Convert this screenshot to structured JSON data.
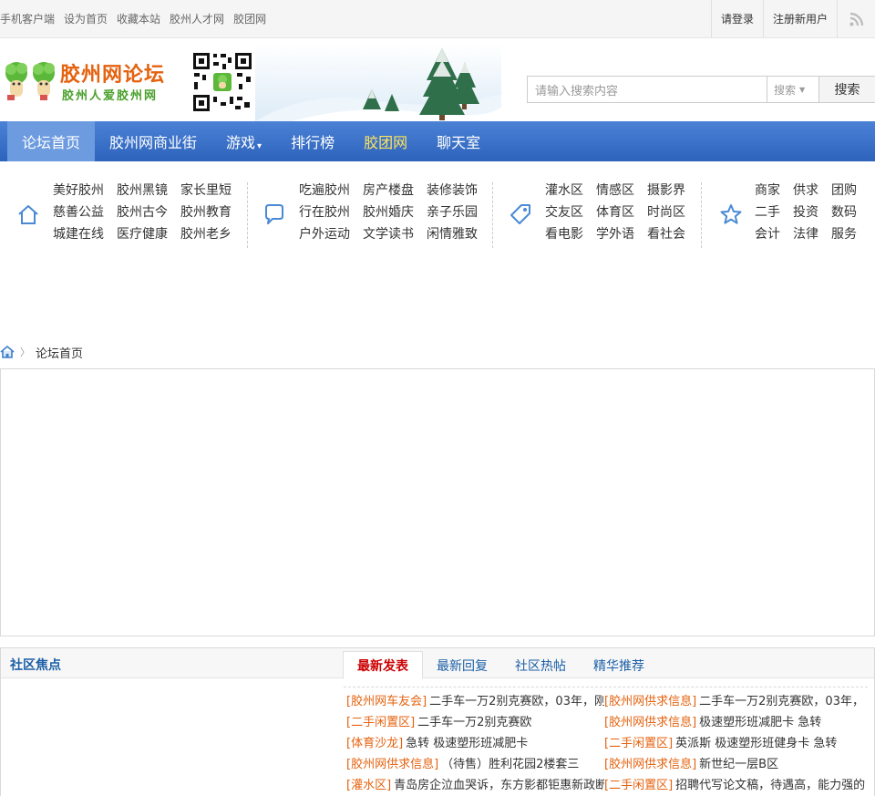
{
  "topbar": {
    "links": [
      "手机客户端",
      "设为首页",
      "收藏本站",
      "胶州人才网",
      "胶团网"
    ],
    "login": "请登录",
    "register": "注册新用户",
    "rss_icon": "rss-icon"
  },
  "header": {
    "logo_title": "胶州网论坛",
    "logo_subtitle": "胶州人爱胶州网",
    "search_placeholder": "请输入搜索内容",
    "search_type": "搜索",
    "search_button": "搜索"
  },
  "nav": {
    "items": [
      "论坛首页",
      "胶州网商业街",
      "游戏",
      "排行榜",
      "胶团网",
      "聊天室"
    ]
  },
  "quick": {
    "groups": [
      {
        "icon": "home-icon",
        "links": [
          "美好胶州",
          "胶州黑镜",
          "家长里短",
          "慈善公益",
          "胶州古今",
          "胶州教育",
          "城建在线",
          "医疗健康",
          "胶州老乡"
        ]
      },
      {
        "icon": "chat-bubble-icon",
        "links": [
          "吃遍胶州",
          "房产楼盘",
          "装修装饰",
          "行在胶州",
          "胶州婚庆",
          "亲子乐园",
          "户外运动",
          "文学读书",
          "闲情雅致"
        ]
      },
      {
        "icon": "tag-icon",
        "links": [
          "灌水区",
          "情感区",
          "摄影界",
          "交友区",
          "体育区",
          "时尚区",
          "看电影",
          "学外语",
          "看社会"
        ]
      },
      {
        "icon": "star-icon",
        "links": [
          "商家",
          "供求",
          "团购",
          "二手",
          "投资",
          "数码",
          "会计",
          "法律",
          "服务"
        ]
      }
    ]
  },
  "breadcrumb": {
    "home_icon": "home-icon",
    "label": "论坛首页"
  },
  "focus": {
    "title": "社区焦点",
    "tabs": [
      "最新发表",
      "最新回复",
      "社区热帖",
      "精华推荐"
    ],
    "active_tab": "最新发表",
    "posts": [
      {
        "cat": "[胶州网车友会]",
        "title": "二手车一万2别克赛欧，03年，刚"
      },
      {
        "cat": "[胶州网供求信息]",
        "title": "二手车一万2别克赛欧，03年，"
      },
      {
        "cat": "[二手闲置区]",
        "title": "二手车一万2别克赛欧"
      },
      {
        "cat": "[胶州网供求信息]",
        "title": "极速塑形班减肥卡 急转"
      },
      {
        "cat": "[体育沙龙]",
        "title": "急转 极速塑形班减肥卡"
      },
      {
        "cat": "[二手闲置区]",
        "title": "英派斯 极速塑形班健身卡 急转"
      },
      {
        "cat": "[胶州网供求信息]",
        "title": "（待售）胜利花园2楼套三"
      },
      {
        "cat": "[胶州网供求信息]",
        "title": "新世纪一层B区"
      },
      {
        "cat": "[灌水区]",
        "title": "青岛房企泣血哭诉，东方影都钜惠新政断"
      },
      {
        "cat": "[二手闲置区]",
        "title": "招聘代写论文稿，待遇高，能力强的"
      }
    ]
  },
  "colors": {
    "nav_blue": "#2d63bb",
    "accent_orange": "#e5620f",
    "link_blue": "#1c5fa6",
    "active_red": "#cc0000"
  }
}
